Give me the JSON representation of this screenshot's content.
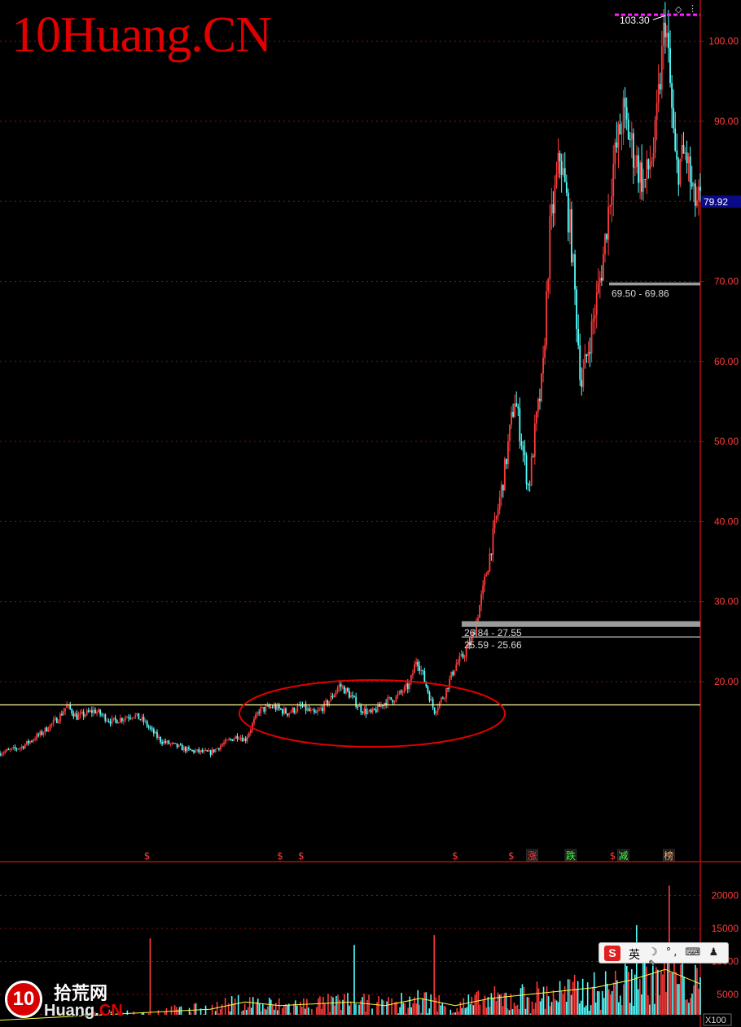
{
  "watermark": "10Huang.CN",
  "logo": {
    "badge": "10",
    "cn": "拾荒网",
    "en_left": "Huang.",
    "en_right": "CN"
  },
  "ime_bar": {
    "logo": "S",
    "lang": "英",
    "icons": "☽ °, ⌨ ♟ ✎"
  },
  "chart_data": [
    {
      "type": "candlestick",
      "price_axis": {
        "ticks": [
          "100.00",
          "90.00",
          "80.00",
          "70.00",
          "60.00",
          "50.00",
          "40.00",
          "30.00",
          "20.00"
        ],
        "tick_values": [
          100,
          90,
          80,
          70,
          60,
          50,
          40,
          30,
          20
        ]
      },
      "last_price_label": "79.92",
      "last_price": 79.92,
      "high_label": "103.30",
      "high_value": 103.3,
      "zones": [
        {
          "label": "69.50 - 69.86",
          "low": 69.5,
          "high": 69.86
        },
        {
          "label": "26.84 - 27.55",
          "low": 26.84,
          "high": 27.55
        },
        {
          "label": "25.59 - 25.66",
          "low": 25.59,
          "high": 25.66
        }
      ],
      "support_line": 17.1,
      "event_markers": [
        {
          "label": "$",
          "position": 0.21
        },
        {
          "label": "$",
          "position": 0.4
        },
        {
          "label": "$",
          "position": 0.43
        },
        {
          "label": "$",
          "position": 0.65
        },
        {
          "label": "$",
          "position": 0.73
        },
        {
          "label": "涨",
          "position": 0.76
        },
        {
          "label": "跌",
          "position": 0.815
        },
        {
          "label": "$",
          "position": 0.875
        },
        {
          "label": "减",
          "position": 0.89
        },
        {
          "label": "榜",
          "position": 0.955
        }
      ],
      "price_path": [
        [
          0,
          11.1
        ],
        [
          0.03,
          11.8
        ],
        [
          0.06,
          13.6
        ],
        [
          0.085,
          15.6
        ],
        [
          0.095,
          17.0
        ],
        [
          0.11,
          15.6
        ],
        [
          0.135,
          16.4
        ],
        [
          0.16,
          15.0
        ],
        [
          0.19,
          15.9
        ],
        [
          0.205,
          15.1
        ],
        [
          0.215,
          14.0
        ],
        [
          0.23,
          12.6
        ],
        [
          0.25,
          12.0
        ],
        [
          0.27,
          11.4
        ],
        [
          0.3,
          11.1
        ],
        [
          0.32,
          12.3
        ],
        [
          0.34,
          13.3
        ],
        [
          0.35,
          12.7
        ],
        [
          0.37,
          16.4
        ],
        [
          0.39,
          16.9
        ],
        [
          0.41,
          16.1
        ],
        [
          0.43,
          16.9
        ],
        [
          0.45,
          15.9
        ],
        [
          0.47,
          17.6
        ],
        [
          0.485,
          19.6
        ],
        [
          0.5,
          18.3
        ],
        [
          0.515,
          16.6
        ],
        [
          0.53,
          16.0
        ],
        [
          0.55,
          17.5
        ],
        [
          0.565,
          18.0
        ],
        [
          0.585,
          19.6
        ],
        [
          0.595,
          23.0
        ],
        [
          0.605,
          20.5
        ],
        [
          0.62,
          16.3
        ],
        [
          0.635,
          18.5
        ],
        [
          0.65,
          22.0
        ],
        [
          0.66,
          23.0
        ],
        [
          0.675,
          25.5
        ],
        [
          0.69,
          31.5
        ],
        [
          0.705,
          38.5
        ],
        [
          0.72,
          46.0
        ],
        [
          0.735,
          55.5
        ],
        [
          0.745,
          50.0
        ],
        [
          0.755,
          44.0
        ],
        [
          0.765,
          52.0
        ],
        [
          0.775,
          58.0
        ],
        [
          0.785,
          76.0
        ],
        [
          0.8,
          86.0
        ],
        [
          0.815,
          76.0
        ],
        [
          0.83,
          57.0
        ],
        [
          0.845,
          64.0
        ],
        [
          0.86,
          72.0
        ],
        [
          0.875,
          84.0
        ],
        [
          0.89,
          91.0
        ],
        [
          0.905,
          86.0
        ],
        [
          0.92,
          82.0
        ],
        [
          0.935,
          87.0
        ],
        [
          0.95,
          103.3
        ],
        [
          0.965,
          84.0
        ],
        [
          0.98,
          86.0
        ],
        [
          0.99,
          80.0
        ],
        [
          1.0,
          79.92
        ]
      ]
    },
    {
      "type": "bar",
      "name_label": "X100",
      "volume_axis": {
        "ticks": [
          "20000",
          "15000",
          "10000",
          "5000"
        ],
        "tick_values": [
          20000,
          15000,
          10000,
          5000
        ]
      },
      "volume_profile": [
        [
          0,
          1000
        ],
        [
          0.1,
          1500
        ],
        [
          0.2,
          2000
        ],
        [
          0.3,
          2500
        ],
        [
          0.35,
          3500
        ],
        [
          0.4,
          3000
        ],
        [
          0.5,
          3500
        ],
        [
          0.55,
          3000
        ],
        [
          0.6,
          4000
        ],
        [
          0.65,
          3000
        ],
        [
          0.7,
          4000
        ],
        [
          0.75,
          4500
        ],
        [
          0.8,
          5000
        ],
        [
          0.85,
          5500
        ],
        [
          0.9,
          6500
        ],
        [
          0.95,
          8000
        ],
        [
          1.0,
          6000
        ]
      ],
      "spikes": [
        {
          "position": 0.215,
          "value": 13500
        },
        {
          "position": 0.505,
          "value": 12500
        },
        {
          "position": 0.62,
          "value": 14000
        },
        {
          "position": 0.91,
          "value": 15500
        },
        {
          "position": 0.955,
          "value": 21500
        }
      ]
    }
  ],
  "colors": {
    "up": "#ff3b3b",
    "down": "#54ffff",
    "grid": "#8a1010",
    "axis_text": "#ff3b3b",
    "support_line": "#ffff9a",
    "ellipse": "#e00000",
    "last_price_bg": "#0a0a88",
    "high_marker": "#ff20ff",
    "zone_fill": "#9b9b9b"
  }
}
